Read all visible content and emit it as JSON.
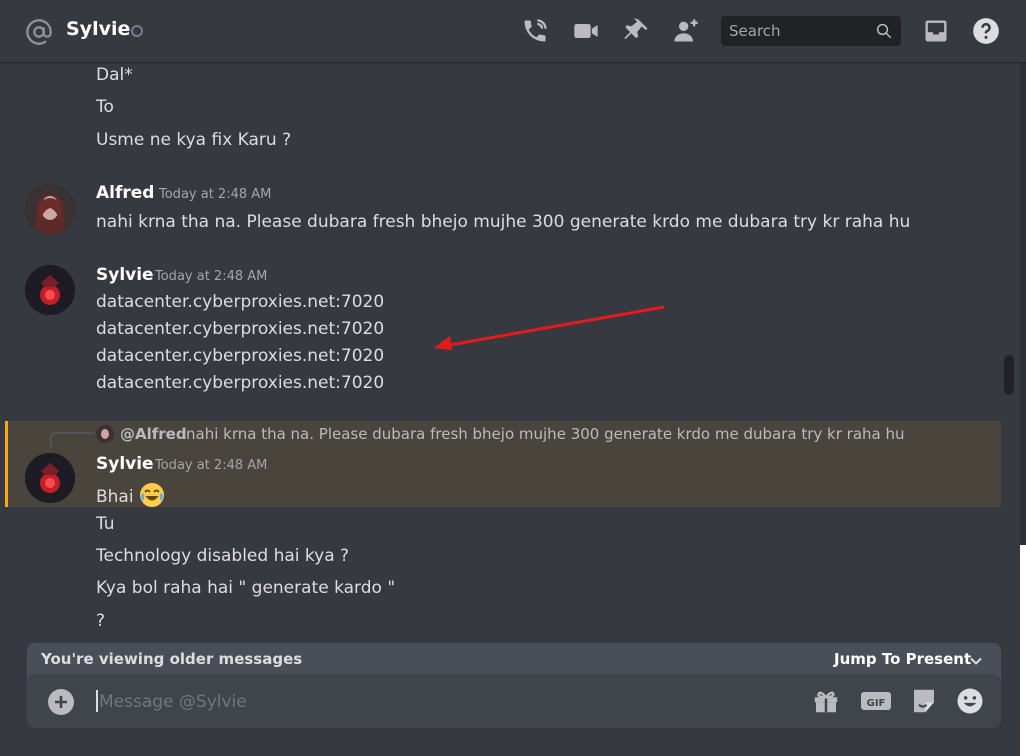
{
  "header": {
    "channel_name": "Sylvie",
    "search_placeholder": "Search"
  },
  "messages": {
    "top_lines": [
      "Dal*",
      "To",
      "Usme ne kya fix Karu ?"
    ],
    "alfred": {
      "author": "Alfred",
      "timestamp": "Today at 2:48 AM",
      "text": "nahi krna tha na. Please dubara fresh bhejo mujhe 300 generate krdo me dubara try kr raha hu"
    },
    "sylvie1": {
      "author": "Sylvie",
      "timestamp": "Today at 2:48 AM",
      "lines": [
        "datacenter.cyberproxies.net:7020",
        "datacenter.cyberproxies.net:7020",
        "datacenter.cyberproxies.net:7020",
        "datacenter.cyberproxies.net:7020"
      ]
    },
    "reply": {
      "author": "@Alfred",
      "text": "nahi krna tha na. Please dubara fresh bhejo mujhe 300 generate krdo me dubara try kr raha hu"
    },
    "sylvie2": {
      "author": "Sylvie",
      "timestamp": "Today at 2:48 AM",
      "first_line": "Bhai",
      "lines": [
        "Tu",
        "Technology disabled hai kya ?",
        "Kya bol raha hai \" generate kardo \"",
        "?"
      ]
    }
  },
  "older_bar": {
    "text": "You're viewing older messages",
    "jump_label": "Jump To Present"
  },
  "composer": {
    "placeholder": "Message @Sylvie"
  },
  "colors": {
    "background": "#36393f",
    "highlight": "#49443c",
    "highlight_bar": "#faa81a",
    "arrow": "#e8191b"
  }
}
